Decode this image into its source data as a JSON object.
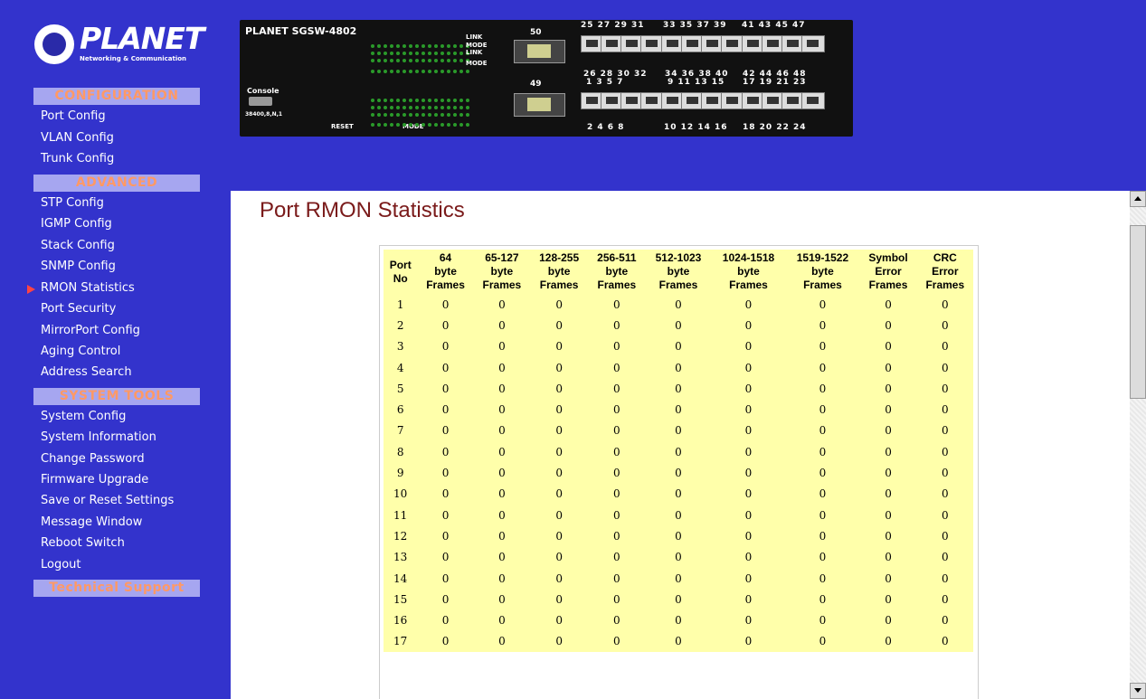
{
  "logo": {
    "brand": "PLANET",
    "tagline": "Networking & Communication"
  },
  "sidebar": {
    "sections": [
      {
        "label": "CONFIGURATION"
      },
      {
        "label": "ADVANCED"
      },
      {
        "label": "SYSTEM TOOLS"
      },
      {
        "label": "Technical Support"
      }
    ],
    "config_items": [
      "Port Config",
      "VLAN Config",
      "Trunk Config"
    ],
    "advanced_items": [
      "STP Config",
      "IGMP Config",
      "Stack Config",
      "SNMP Config",
      "RMON Statistics",
      "Port Security",
      "MirrorPort Config",
      "Aging Control",
      "Address Search"
    ],
    "tools_items": [
      "System Config",
      "System Information",
      "Change Password",
      "Firmware Upgrade",
      "Save or Reset Settings",
      "Message Window",
      "Reboot Switch",
      "Logout"
    ],
    "active_item": "RMON Statistics"
  },
  "panel": {
    "brand": "PLANET SGSW-4802",
    "console": "Console",
    "baud": "38400,8,N,1",
    "reset": "RESET",
    "mode": "MODE",
    "led_labels": [
      "LINK",
      "MODE",
      "LINK",
      "MODE"
    ],
    "sfp_top": "50",
    "sfp_bottom": "49",
    "top_numbers": [
      "25 27 29 31",
      "33 35 37 39",
      "41 43 45 47"
    ],
    "mid_upper": [
      "26 28 30 32",
      "34 36 38 40",
      "42 44 46 48"
    ],
    "mid_lower": [
      "1 3 5 7",
      "9 11 13 15",
      "17 19 21 23"
    ],
    "bottom_numbers": [
      "2 4 6 8",
      "10 12 14 16",
      "18 20 22 24"
    ]
  },
  "page": {
    "title": "Port RMON Statistics"
  },
  "table": {
    "headers": [
      [
        "Port",
        "No"
      ],
      [
        "64",
        "byte",
        "Frames"
      ],
      [
        "65-127",
        "byte",
        "Frames"
      ],
      [
        "128-255",
        "byte",
        "Frames"
      ],
      [
        "256-511",
        "byte",
        "Frames"
      ],
      [
        "512-1023",
        "byte",
        "Frames"
      ],
      [
        "1024-1518",
        "byte",
        "Frames"
      ],
      [
        "1519-1522",
        "byte",
        "Frames"
      ],
      [
        "Symbol",
        "Error",
        "Frames"
      ],
      [
        "CRC",
        "Error",
        "Frames"
      ]
    ],
    "rows": [
      [
        "1",
        "0",
        "0",
        "0",
        "0",
        "0",
        "0",
        "0",
        "0",
        "0"
      ],
      [
        "2",
        "0",
        "0",
        "0",
        "0",
        "0",
        "0",
        "0",
        "0",
        "0"
      ],
      [
        "3",
        "0",
        "0",
        "0",
        "0",
        "0",
        "0",
        "0",
        "0",
        "0"
      ],
      [
        "4",
        "0",
        "0",
        "0",
        "0",
        "0",
        "0",
        "0",
        "0",
        "0"
      ],
      [
        "5",
        "0",
        "0",
        "0",
        "0",
        "0",
        "0",
        "0",
        "0",
        "0"
      ],
      [
        "6",
        "0",
        "0",
        "0",
        "0",
        "0",
        "0",
        "0",
        "0",
        "0"
      ],
      [
        "7",
        "0",
        "0",
        "0",
        "0",
        "0",
        "0",
        "0",
        "0",
        "0"
      ],
      [
        "8",
        "0",
        "0",
        "0",
        "0",
        "0",
        "0",
        "0",
        "0",
        "0"
      ],
      [
        "9",
        "0",
        "0",
        "0",
        "0",
        "0",
        "0",
        "0",
        "0",
        "0"
      ],
      [
        "10",
        "0",
        "0",
        "0",
        "0",
        "0",
        "0",
        "0",
        "0",
        "0"
      ],
      [
        "11",
        "0",
        "0",
        "0",
        "0",
        "0",
        "0",
        "0",
        "0",
        "0"
      ],
      [
        "12",
        "0",
        "0",
        "0",
        "0",
        "0",
        "0",
        "0",
        "0",
        "0"
      ],
      [
        "13",
        "0",
        "0",
        "0",
        "0",
        "0",
        "0",
        "0",
        "0",
        "0"
      ],
      [
        "14",
        "0",
        "0",
        "0",
        "0",
        "0",
        "0",
        "0",
        "0",
        "0"
      ],
      [
        "15",
        "0",
        "0",
        "0",
        "0",
        "0",
        "0",
        "0",
        "0",
        "0"
      ],
      [
        "16",
        "0",
        "0",
        "0",
        "0",
        "0",
        "0",
        "0",
        "0",
        "0"
      ],
      [
        "17",
        "0",
        "0",
        "0",
        "0",
        "0",
        "0",
        "0",
        "0",
        "0"
      ]
    ]
  },
  "colors": {
    "background": "#3333cc",
    "section_bg": "#a6a6f0",
    "section_text": "#ff9966",
    "table_bg": "#ffffaa",
    "title": "#7a1a1a"
  }
}
